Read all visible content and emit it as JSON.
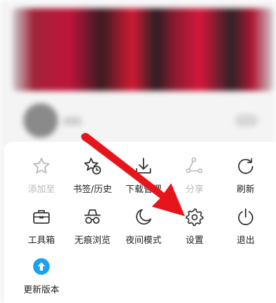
{
  "menu": {
    "items": [
      {
        "label": "添加至",
        "icon": "star-icon",
        "enabled": false
      },
      {
        "label": "书签/历史",
        "icon": "bookmark-history-icon",
        "enabled": true
      },
      {
        "label": "下载管理",
        "icon": "download-icon",
        "enabled": true
      },
      {
        "label": "分享",
        "icon": "share-icon",
        "enabled": false
      },
      {
        "label": "刷新",
        "icon": "refresh-icon",
        "enabled": true
      },
      {
        "label": "工具箱",
        "icon": "toolbox-icon",
        "enabled": true
      },
      {
        "label": "无痕浏览",
        "icon": "incognito-icon",
        "enabled": true
      },
      {
        "label": "夜间模式",
        "icon": "moon-icon",
        "enabled": true
      },
      {
        "label": "设置",
        "icon": "gear-icon",
        "enabled": true
      },
      {
        "label": "退出",
        "icon": "power-icon",
        "enabled": true
      },
      {
        "label": "更新版本",
        "icon": "update-icon",
        "enabled": true
      }
    ]
  },
  "colors": {
    "accent": "#1aa2f0",
    "annotation_arrow": "#e8141b",
    "icon": "#333333",
    "icon_disabled": "#b8b8b8"
  }
}
